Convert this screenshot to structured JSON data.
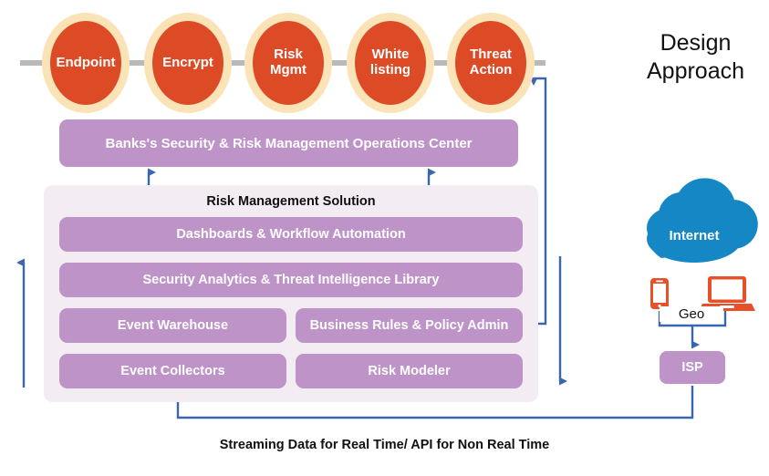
{
  "heading": {
    "line1": "Design",
    "line2": "Approach"
  },
  "pipeline": {
    "stages": [
      {
        "label": "Endpoint",
        "lines": [
          "Endpoint"
        ]
      },
      {
        "label": "Encrypt",
        "lines": [
          "Encrypt"
        ]
      },
      {
        "label": "Risk Mgmt",
        "lines": [
          "Risk",
          "Mgmt"
        ]
      },
      {
        "label": "White listing",
        "lines": [
          "White",
          "listing"
        ]
      },
      {
        "label": "Threat Action",
        "lines": [
          "Threat",
          "Action"
        ]
      }
    ]
  },
  "soc": {
    "label": "Banks's Security & Risk Management Operations Center"
  },
  "solution": {
    "title": "Risk Management Solution",
    "blocks": [
      {
        "label": "Dashboards & Workflow Automation",
        "width": "wide"
      },
      {
        "label": "Security Analytics & Threat Intelligence Library",
        "width": "wide"
      },
      {
        "label": "Event Warehouse",
        "width": "half-left"
      },
      {
        "label": "Business Rules & Policy Admin",
        "width": "half-right"
      },
      {
        "label": "Event Collectors",
        "width": "half-left"
      },
      {
        "label": "Risk Modeler",
        "width": "half-right"
      }
    ]
  },
  "network": {
    "cloud_label": "Internet",
    "geo_label": "Geo",
    "isp_label": "ISP",
    "devices": [
      "smartphone-icon",
      "laptop-icon"
    ]
  },
  "footer": {
    "caption": "Streaming Data for Real Time/ API for Non Real Time"
  },
  "colors": {
    "stage_fill": "#dd4b26",
    "stage_ring": "#fae3b6",
    "rail": "#b9b9b9",
    "purple_block": "#bd93c8",
    "panel_bg": "#f3ecf3",
    "arrow_blue": "#3a66b0",
    "cloud_blue": "#1487c4",
    "device_orange": "#e8502a",
    "text_dark": "#111111",
    "text_light": "#ffffff"
  }
}
